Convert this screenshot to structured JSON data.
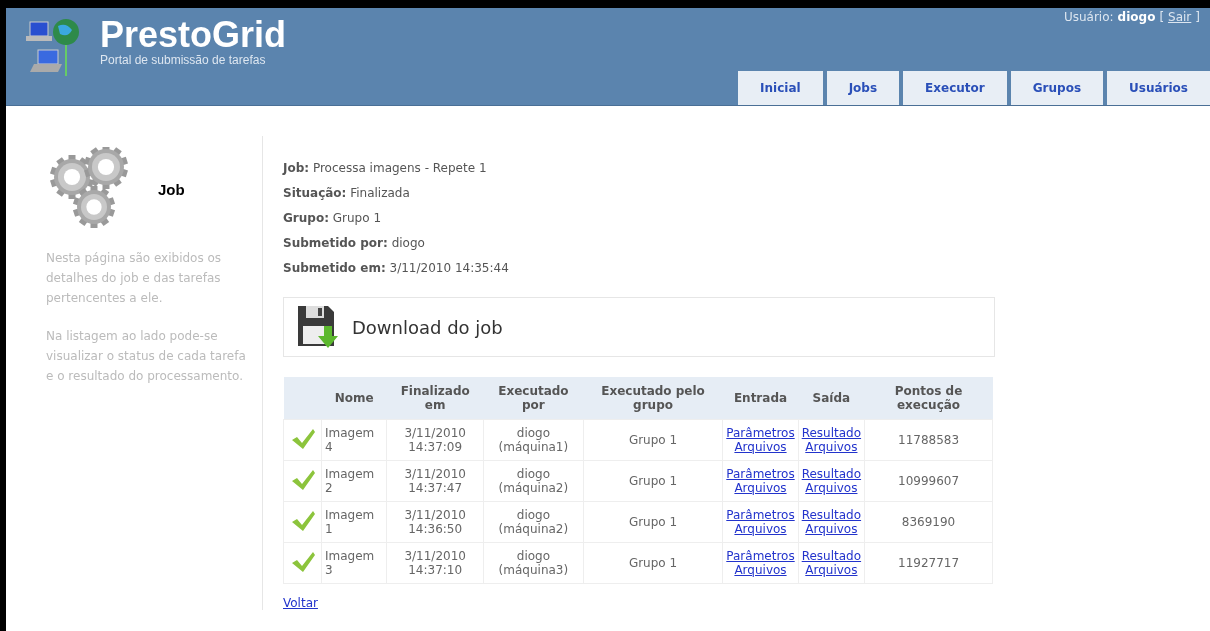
{
  "header": {
    "title": "PrestoGrid",
    "subtitle": "Portal de submissão de tarefas",
    "user_label": "Usuário:",
    "user_name": "diogo",
    "bracket_open": "[",
    "logout": "Sair",
    "bracket_close": "]"
  },
  "tabs": [
    {
      "label": "Inicial",
      "selected": false
    },
    {
      "label": "Jobs",
      "selected": false
    },
    {
      "label": "Executor",
      "selected": false
    },
    {
      "label": "Grupos",
      "selected": false
    },
    {
      "label": "Usuários",
      "selected": false
    }
  ],
  "sidebar": {
    "title": "Job",
    "paragraphs": [
      "Nesta página são exibidos os detalhes do job e das tarefas pertencentes a ele.",
      "Na listagem ao lado pode-se visualizar o status de cada tarefa e o resultado do processamento."
    ]
  },
  "details": [
    {
      "label": "Job:",
      "value": "Processa imagens - Repete 1"
    },
    {
      "label": "Situação:",
      "value": "Finalizada"
    },
    {
      "label": "Grupo:",
      "value": "Grupo 1"
    },
    {
      "label": "Submetido por:",
      "value": "diogo"
    },
    {
      "label": "Submetido em:",
      "value": "3/11/2010 14:35:44"
    }
  ],
  "download": {
    "label": "Download do job"
  },
  "table": {
    "columns": [
      "Nome",
      "Finalizado em",
      "Executado por",
      "Executado pelo grupo",
      "Entrada",
      "Saída",
      "Pontos de execução"
    ],
    "rows": [
      {
        "done": true,
        "name": "Imagem 4",
        "finished": [
          "3/11/2010",
          "14:37:09"
        ],
        "by": [
          "diogo",
          "(máquina1)"
        ],
        "group": "Grupo 1",
        "input": [
          "Parâmetros",
          "Arquivos"
        ],
        "output": [
          "Resultado",
          "Arquivos"
        ],
        "points": "11788583"
      },
      {
        "done": true,
        "name": "Imagem 2",
        "finished": [
          "3/11/2010",
          "14:37:47"
        ],
        "by": [
          "diogo",
          "(máquina2)"
        ],
        "group": "Grupo 1",
        "input": [
          "Parâmetros",
          "Arquivos"
        ],
        "output": [
          "Resultado",
          "Arquivos"
        ],
        "points": "10999607"
      },
      {
        "done": true,
        "name": "Imagem 1",
        "finished": [
          "3/11/2010",
          "14:36:50"
        ],
        "by": [
          "diogo",
          "(máquina2)"
        ],
        "group": "Grupo 1",
        "input": [
          "Parâmetros",
          "Arquivos"
        ],
        "output": [
          "Resultado",
          "Arquivos"
        ],
        "points": "8369190"
      },
      {
        "done": true,
        "name": "Imagem 3",
        "finished": [
          "3/11/2010",
          "14:37:10"
        ],
        "by": [
          "diogo",
          "(máquina3)"
        ],
        "group": "Grupo 1",
        "input": [
          "Parâmetros",
          "Arquivos"
        ],
        "output": [
          "Resultado",
          "Arquivos"
        ],
        "points": "11927717"
      }
    ]
  },
  "back_link": "Voltar"
}
